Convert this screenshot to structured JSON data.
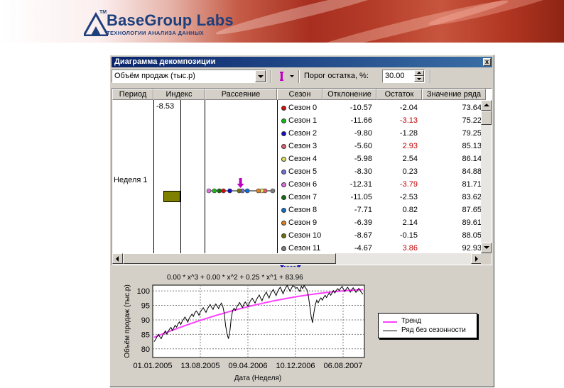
{
  "banner": {
    "brand_name": "BaseGroup Labs",
    "brand_tm": "TM",
    "tagline": "ТЕХНОЛОГИИ АНАЛИЗА ДАННЫХ"
  },
  "window": {
    "title": "Диаграмма декомпозиции",
    "close_label": "x"
  },
  "toolbar": {
    "series_value": "Объём продаж (тыс.р)",
    "threshold_label": "Порог остатка, %:",
    "threshold_value": "30.00",
    "marker_icon": "marker-icon",
    "marker_color": "#c000c0"
  },
  "grid": {
    "columns": [
      "Период",
      "Индекс",
      "Рассеяние",
      "Сезон",
      "Отклонение",
      "Остаток",
      "Значение ряда"
    ],
    "period": "Неделя 1",
    "index_top_label": "-8.53",
    "highlight_color": "#c00000",
    "rows": [
      {
        "season": "Сезон 0",
        "color": "#d01010",
        "deviation": "-10.57",
        "remainder": "-2.04",
        "value": "73.64",
        "flag": false
      },
      {
        "season": "Сезон 1",
        "color": "#10c010",
        "deviation": "-11.66",
        "remainder": "-3.13",
        "value": "75.22",
        "flag": true
      },
      {
        "season": "Сезон 2",
        "color": "#1010c0",
        "deviation": "-9.80",
        "remainder": "-1.28",
        "value": "79.25",
        "flag": false
      },
      {
        "season": "Сезон 3",
        "color": "#e06070",
        "deviation": "-5.60",
        "remainder": "2.93",
        "value": "85.13",
        "flag": true
      },
      {
        "season": "Сезон 4",
        "color": "#e0e060",
        "deviation": "-5.98",
        "remainder": "2.54",
        "value": "86.14",
        "flag": false
      },
      {
        "season": "Сезон 5",
        "color": "#7070e0",
        "deviation": "-8.30",
        "remainder": "0.23",
        "value": "84.88",
        "flag": false
      },
      {
        "season": "Сезон 6",
        "color": "#e070e0",
        "deviation": "-12.31",
        "remainder": "-3.79",
        "value": "81.71",
        "flag": true
      },
      {
        "season": "Сезон 7",
        "color": "#107010",
        "deviation": "-11.05",
        "remainder": "-2.53",
        "value": "83.62",
        "flag": false
      },
      {
        "season": "Сезон 8",
        "color": "#1070d0",
        "deviation": "-7.71",
        "remainder": "0.82",
        "value": "87.65",
        "flag": false
      },
      {
        "season": "Сезон 9",
        "color": "#e08020",
        "deviation": "-6.39",
        "remainder": "2.14",
        "value": "89.61",
        "flag": false
      },
      {
        "season": "Сезон 10",
        "color": "#707010",
        "deviation": "-8.67",
        "remainder": "-0.15",
        "value": "88.05",
        "flag": false
      },
      {
        "season": "Сезон 11",
        "color": "#808080",
        "deviation": "-4.67",
        "remainder": "3.86",
        "value": "92.93",
        "flag": true
      }
    ]
  },
  "chart_data": {
    "type": "line",
    "formula": "0.00 * x^3 +   0.00 * x^2 +   0.25 * x^1 +  83.96",
    "xlabel": "Дата (Неделя)",
    "ylabel": "Объём продаж (тыс.р)",
    "x_ticks": [
      "01.01.2005",
      "13.08.2005",
      "09.04.2006",
      "10.12.2006",
      "06.08.2007"
    ],
    "y_ticks": [
      80,
      85,
      90,
      95,
      100
    ],
    "ylim": [
      77,
      102
    ],
    "n_points": 150,
    "grid": true,
    "legend_position": "right",
    "series": [
      {
        "name": "Тренд",
        "color": "#ff40ff",
        "start": 83.96,
        "end": 100.5
      },
      {
        "name": "Ряд без сезонности",
        "color": "#000000",
        "values": [
          82.5,
          83.2,
          84.1,
          85.0,
          84.2,
          83.5,
          84.6,
          85.4,
          86.2,
          85.1,
          86.0,
          86.8,
          87.4,
          86.3,
          87.2,
          88.1,
          87.5,
          88.6,
          89.3,
          88.4,
          89.5,
          90.2,
          91.0,
          90.1,
          89.2,
          90.5,
          91.3,
          92.0,
          91.2,
          92.4,
          93.1,
          92.5,
          91.6,
          92.8,
          93.5,
          94.2,
          93.4,
          92.6,
          93.8,
          94.6,
          95.3,
          94.4,
          93.6,
          94.8,
          95.5,
          94.7,
          93.9,
          95.0,
          95.8,
          94.6,
          92.3,
          88.0,
          85.2,
          83.5,
          86.0,
          90.5,
          93.2,
          94.0,
          93.3,
          94.5,
          95.2,
          96.0,
          95.1,
          94.3,
          95.4,
          96.2,
          95.5,
          94.7,
          95.9,
          96.8,
          97.5,
          96.6,
          95.8,
          97.0,
          97.8,
          98.6,
          97.5,
          96.6,
          97.9,
          98.8,
          99.6,
          98.5,
          97.6,
          98.9,
          99.8,
          100.5,
          99.4,
          98.4,
          99.7,
          100.6,
          101.3,
          100.2,
          99.0,
          100.3,
          101.2,
          101.9,
          100.8,
          99.9,
          101.0,
          101.8,
          101.5,
          100.9,
          101.2,
          100.5,
          99.8,
          101.6,
          100.8,
          101.9,
          101.1,
          100.4,
          98.5,
          95.0,
          91.2,
          89.0,
          92.5,
          95.3,
          96.8,
          95.9,
          96.9,
          97.6,
          96.8,
          97.8,
          98.5,
          97.7,
          98.6,
          99.3,
          98.5,
          99.4,
          100.1,
          99.3,
          100.2,
          100.8,
          100.1,
          100.9,
          101.5,
          100.7,
          99.8,
          100.6,
          101.3,
          100.5,
          99.6,
          100.4,
          101.1,
          100.3,
          99.5,
          100.2,
          100.9,
          100.1,
          99.4,
          98.9
        ]
      }
    ]
  }
}
